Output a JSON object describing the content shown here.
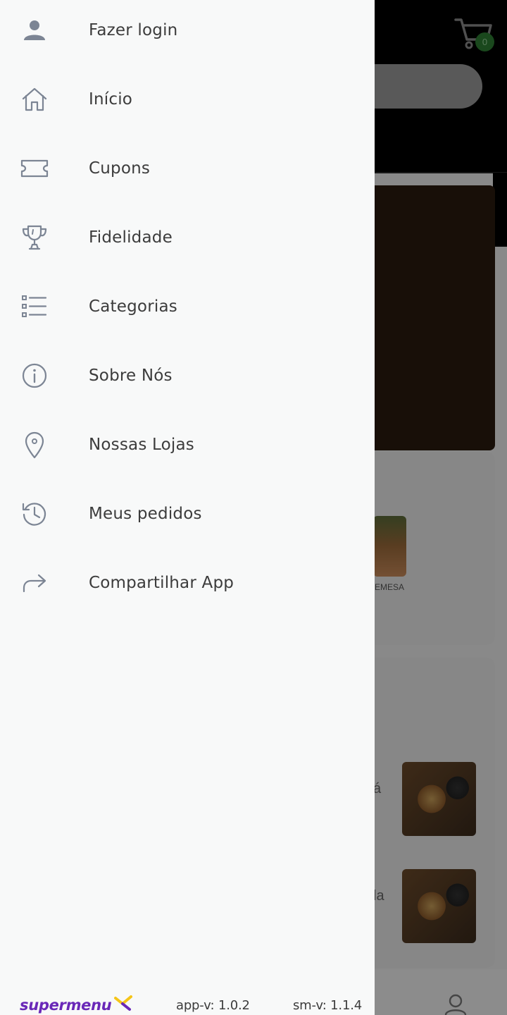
{
  "drawer": {
    "items": [
      {
        "label": "Fazer login",
        "icon": "person-icon"
      },
      {
        "label": "Início",
        "icon": "home-icon"
      },
      {
        "label": "Cupons",
        "icon": "ticket-icon"
      },
      {
        "label": "Fidelidade",
        "icon": "trophy-icon"
      },
      {
        "label": "Categorias",
        "icon": "list-icon"
      },
      {
        "label": "Sobre Nós",
        "icon": "info-icon"
      },
      {
        "label": "Nossas Lojas",
        "icon": "location-pin-icon"
      },
      {
        "label": "Meus pedidos",
        "icon": "history-icon"
      },
      {
        "label": "Compartilhar App",
        "icon": "share-icon"
      }
    ],
    "footer": {
      "logo_text": "supermenu",
      "app_version": "app-v: 1.0.2",
      "sm_version": "sm-v: 1.1.4"
    }
  },
  "background": {
    "cart_count": "0",
    "card_caption": "EMESA",
    "fragment_1": "á",
    "fragment_2": "la"
  },
  "colors": {
    "drawer_bg": "#f8f9f9",
    "icon_gray": "#7c8594",
    "text": "#3c3c3c",
    "brand_purple": "#6a28b8",
    "brand_yellow": "#f5c518",
    "cart_badge": "#2e7d32"
  }
}
